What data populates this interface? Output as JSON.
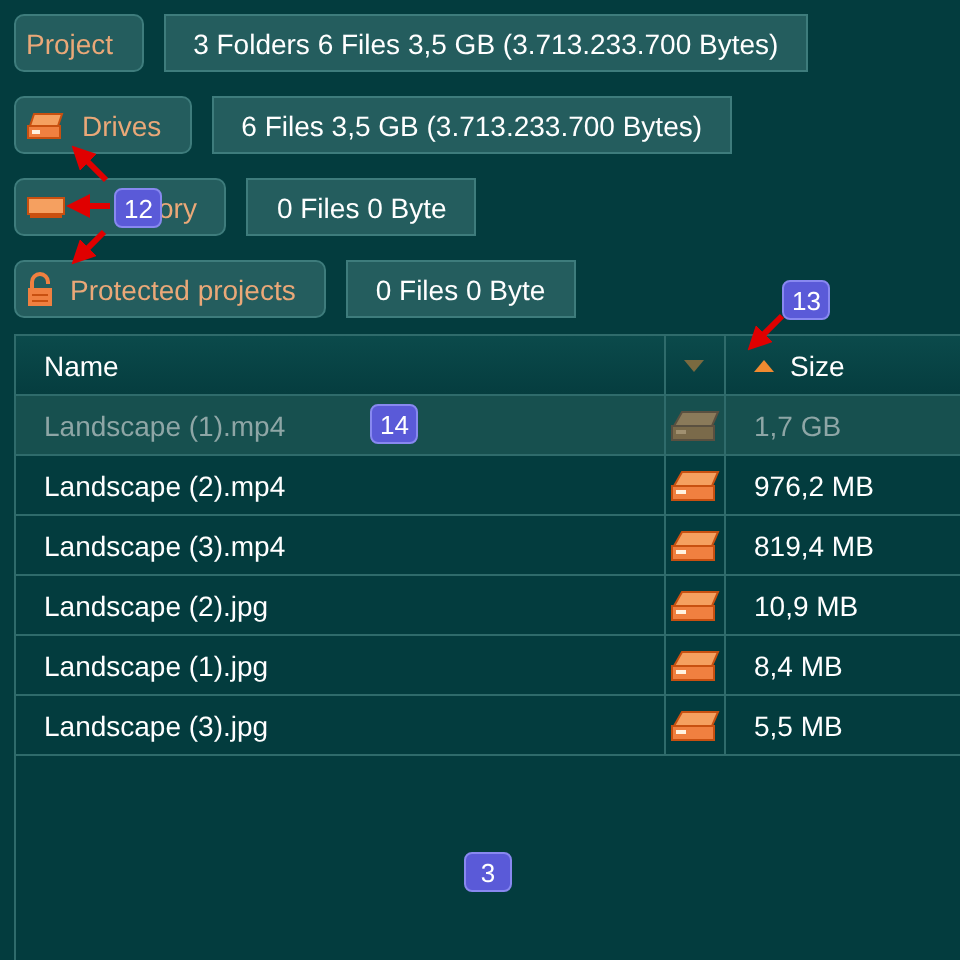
{
  "buttons": [
    {
      "label": "Project",
      "kind": "none",
      "info": "3 Folders  6 Files  3,5 GB (3.713.233.700 Bytes)"
    },
    {
      "label": "Drives",
      "kind": "drive",
      "info": "6 Files  3,5 GB (3.713.233.700 Bytes)"
    },
    {
      "label": "ory",
      "covered_start": true,
      "kind": "memory",
      "info": "0 Files  0 Byte"
    },
    {
      "label": "Protected projects",
      "kind": "lock",
      "info": "0 Files  0 Byte"
    }
  ],
  "table": {
    "columns": [
      {
        "kind": "text",
        "label": "Name",
        "sorted": false
      },
      {
        "kind": "icon"
      },
      {
        "kind": "text",
        "label": "Size",
        "sorted": true
      }
    ],
    "rows": [
      {
        "name": "Landscape (1).mp4",
        "size": "1,7 GB",
        "selected": true
      },
      {
        "name": "Landscape (2).mp4",
        "size": "976,2 MB",
        "selected": false
      },
      {
        "name": "Landscape (3).mp4",
        "size": "819,4 MB",
        "selected": false
      },
      {
        "name": "Landscape (2).jpg",
        "size": "10,9 MB",
        "selected": false
      },
      {
        "name": "Landscape (1).jpg",
        "size": "8,4 MB",
        "selected": false
      },
      {
        "name": "Landscape (3).jpg",
        "size": "5,5 MB",
        "selected": false
      }
    ]
  },
  "annotations": [
    {
      "number": "12"
    },
    {
      "number": "13"
    },
    {
      "number": "14"
    },
    {
      "number": "3"
    }
  ]
}
